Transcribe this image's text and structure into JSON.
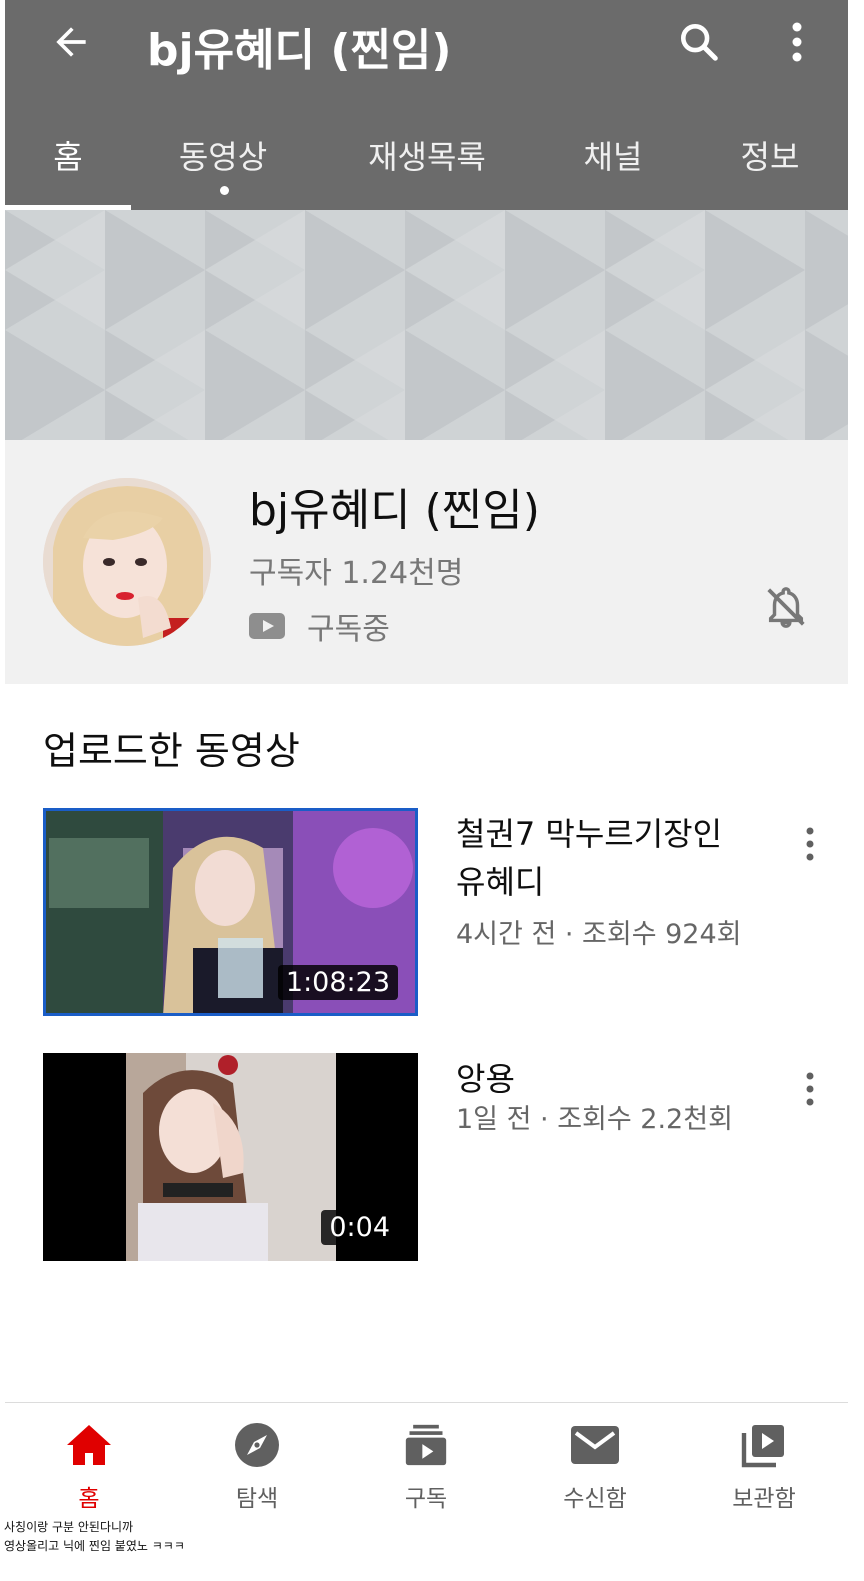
{
  "header": {
    "title": "bj유혜디 (찐임)",
    "tabs": [
      {
        "label": "홈",
        "active": true
      },
      {
        "label": "동영상",
        "has_dot": true
      },
      {
        "label": "재생목록"
      },
      {
        "label": "채널"
      },
      {
        "label": "정보"
      }
    ],
    "icons": [
      "back-arrow-icon",
      "search-icon",
      "more-vertical-icon"
    ]
  },
  "channel": {
    "name": "bj유혜디 (찐임)",
    "subscribers": "구독자 1.24천명",
    "subscription_status": "구독중",
    "notification_icon": "bell-off-icon"
  },
  "uploads": {
    "section_title": "업로드한 동영상",
    "videos": [
      {
        "title": "철권7 막누르기장인 유혜디",
        "meta": "4시간 전 · 조회수 924회",
        "duration": "1:08:23"
      },
      {
        "title": "앙용",
        "meta": "1일 전 · 조회수 2.2천회",
        "duration": "0:04"
      }
    ]
  },
  "bottom_nav": {
    "items": [
      {
        "label": "홈",
        "icon": "home-icon",
        "active": true
      },
      {
        "label": "탐색",
        "icon": "explore-compass-icon"
      },
      {
        "label": "구독",
        "icon": "subscriptions-icon"
      },
      {
        "label": "수신함",
        "icon": "inbox-mail-icon"
      },
      {
        "label": "보관함",
        "icon": "library-icon"
      }
    ]
  },
  "captions": [
    "사칭이랑 구분 안된다니까",
    "영상올리고 닉에 찐임 붙였노 ㅋㅋㅋ"
  ],
  "colors": {
    "appbar": "#6b6b6b",
    "accent_red": "#e00000",
    "selection_blue": "#1a5dc7"
  }
}
